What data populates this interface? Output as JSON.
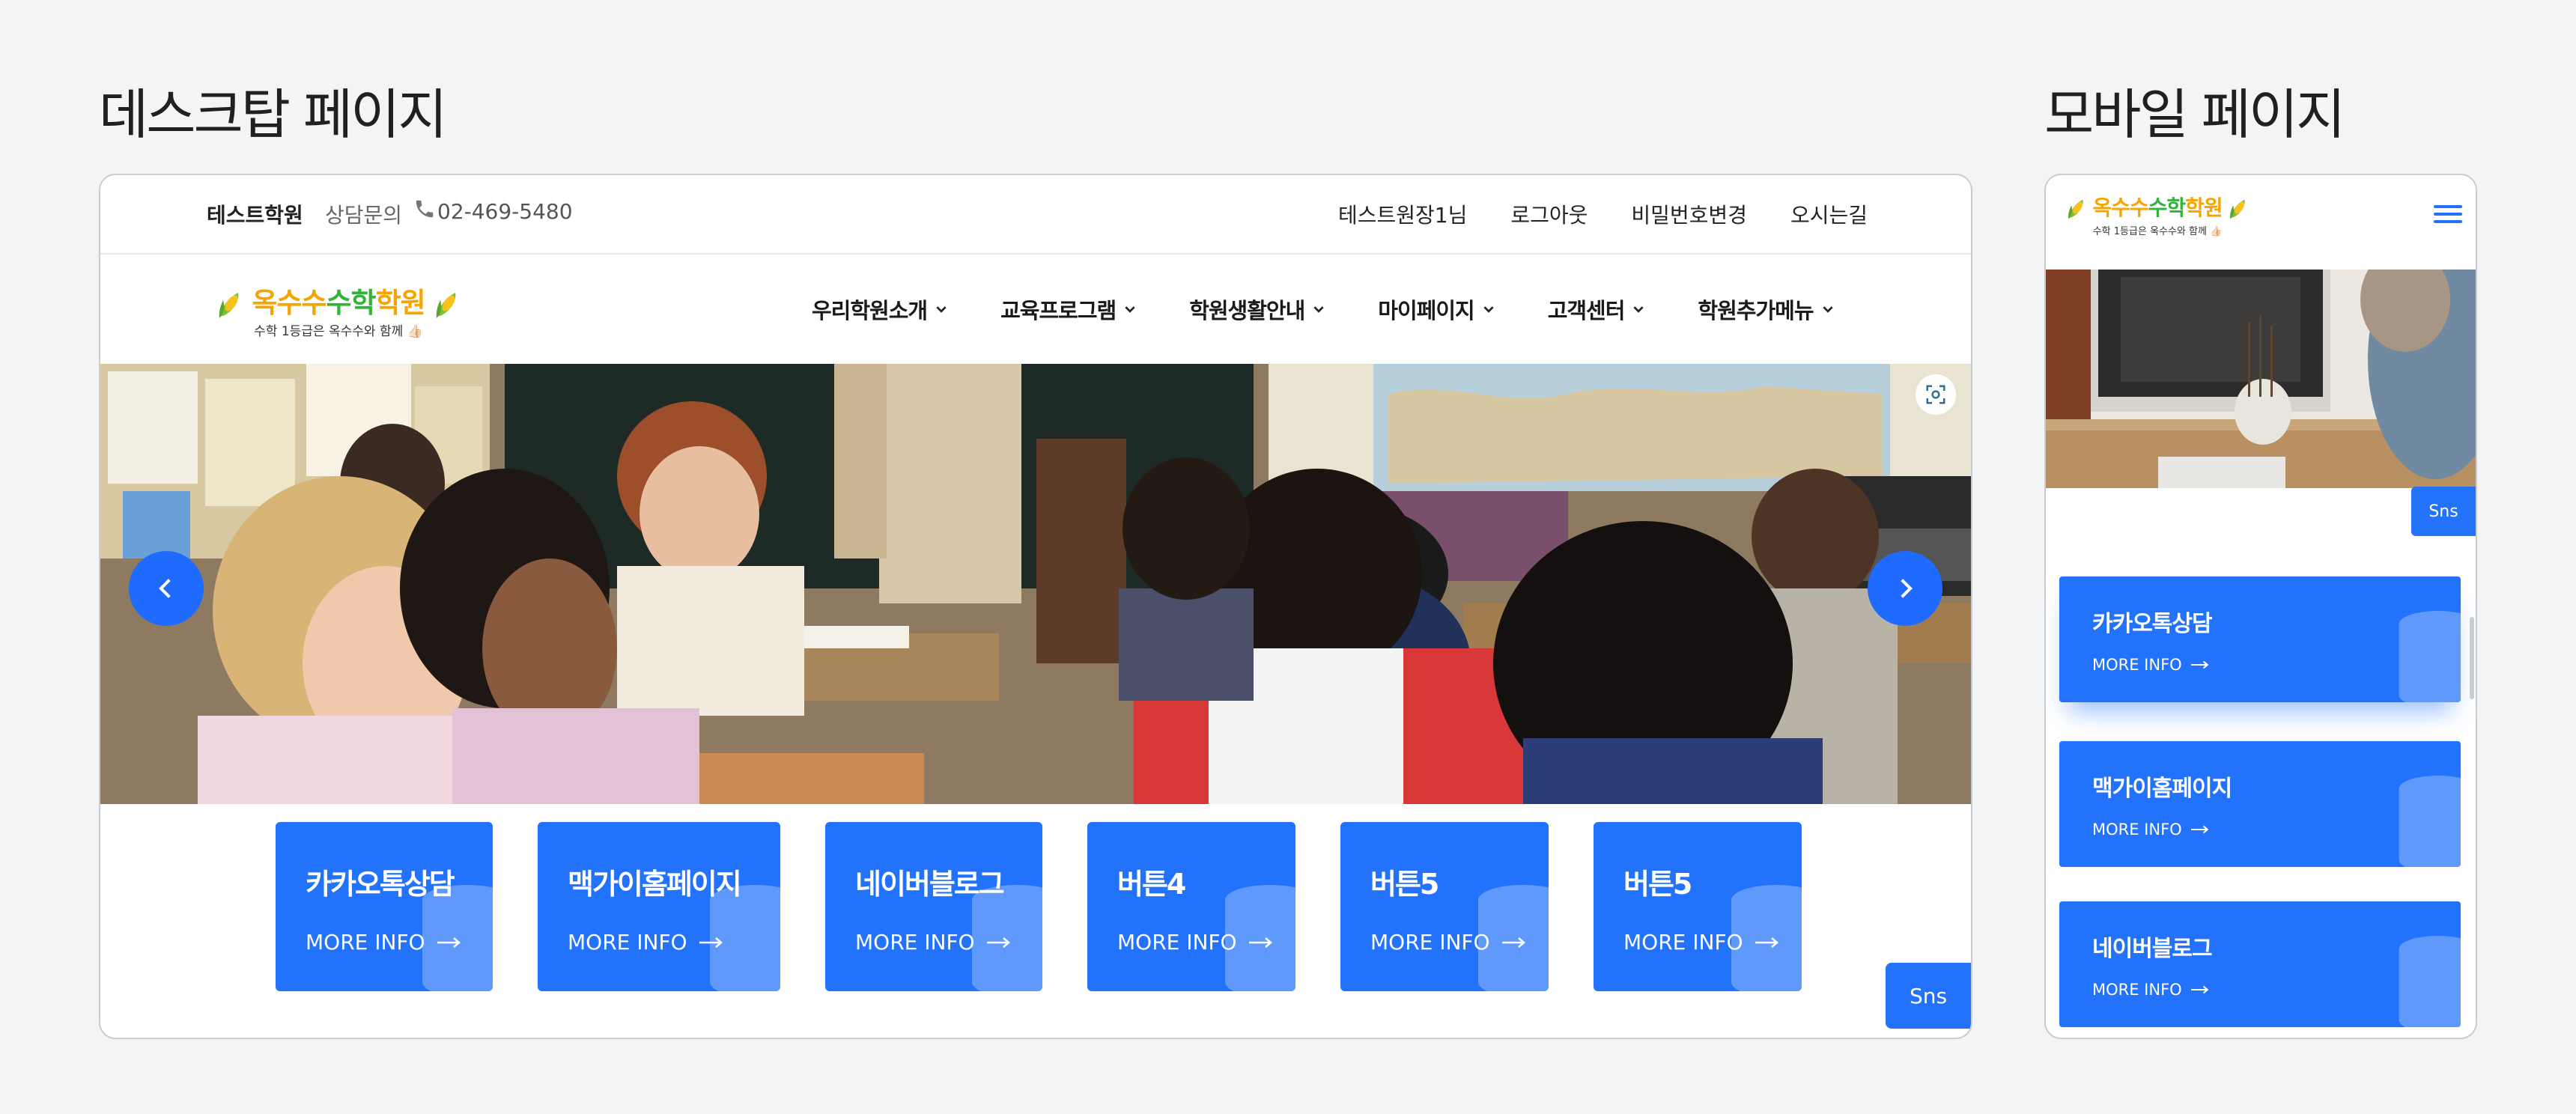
{
  "labels": {
    "desktop_title": "데스크탑 페이지",
    "mobile_title": "모바일 페이지"
  },
  "topbar": {
    "brand": "테스트학원",
    "consult_label": "상담문의",
    "phone": "02-469-5480",
    "links": [
      "테스트원장1님",
      "로그아웃",
      "비밀번호변경",
      "오시는길"
    ]
  },
  "logo": {
    "title_part1": "옥수수",
    "title_part2": "수학",
    "title_part3": "학원",
    "subtitle": "수학 1등급은 옥수수와 함께 👍🏻"
  },
  "nav": {
    "items": [
      "우리학원소개",
      "교육프로그램",
      "학원생활안내",
      "마이페이지",
      "고객센터",
      "학원추가메뉴"
    ]
  },
  "quick_buttons": [
    {
      "title": "카카오톡상담",
      "more": "MORE INFO"
    },
    {
      "title": "맥가이홈페이지",
      "more": "MORE INFO"
    },
    {
      "title": "네이버블로그",
      "more": "MORE INFO"
    },
    {
      "title": "버튼4",
      "more": "MORE INFO"
    },
    {
      "title": "버튼5",
      "more": "MORE INFO"
    },
    {
      "title": "버튼5",
      "more": "MORE INFO"
    }
  ],
  "sns_label": "Sns",
  "mobile": {
    "sns_label": "Sns",
    "buttons": [
      {
        "title": "카카오톡상담",
        "more": "MORE INFO"
      },
      {
        "title": "맥가이홈페이지",
        "more": "MORE INFO"
      },
      {
        "title": "네이버블로그",
        "more": "MORE INFO"
      }
    ]
  },
  "colors": {
    "primary": "#2272fb",
    "logo_orange": "#f6a400",
    "logo_green": "#34b33a",
    "background": "#f3f4f6"
  },
  "icons": [
    "phone-icon",
    "chevron-down-icon",
    "chevron-left-icon",
    "chevron-right-icon",
    "scan-icon",
    "arrow-right-icon",
    "database-icon",
    "hamburger-icon",
    "corn-icon"
  ]
}
